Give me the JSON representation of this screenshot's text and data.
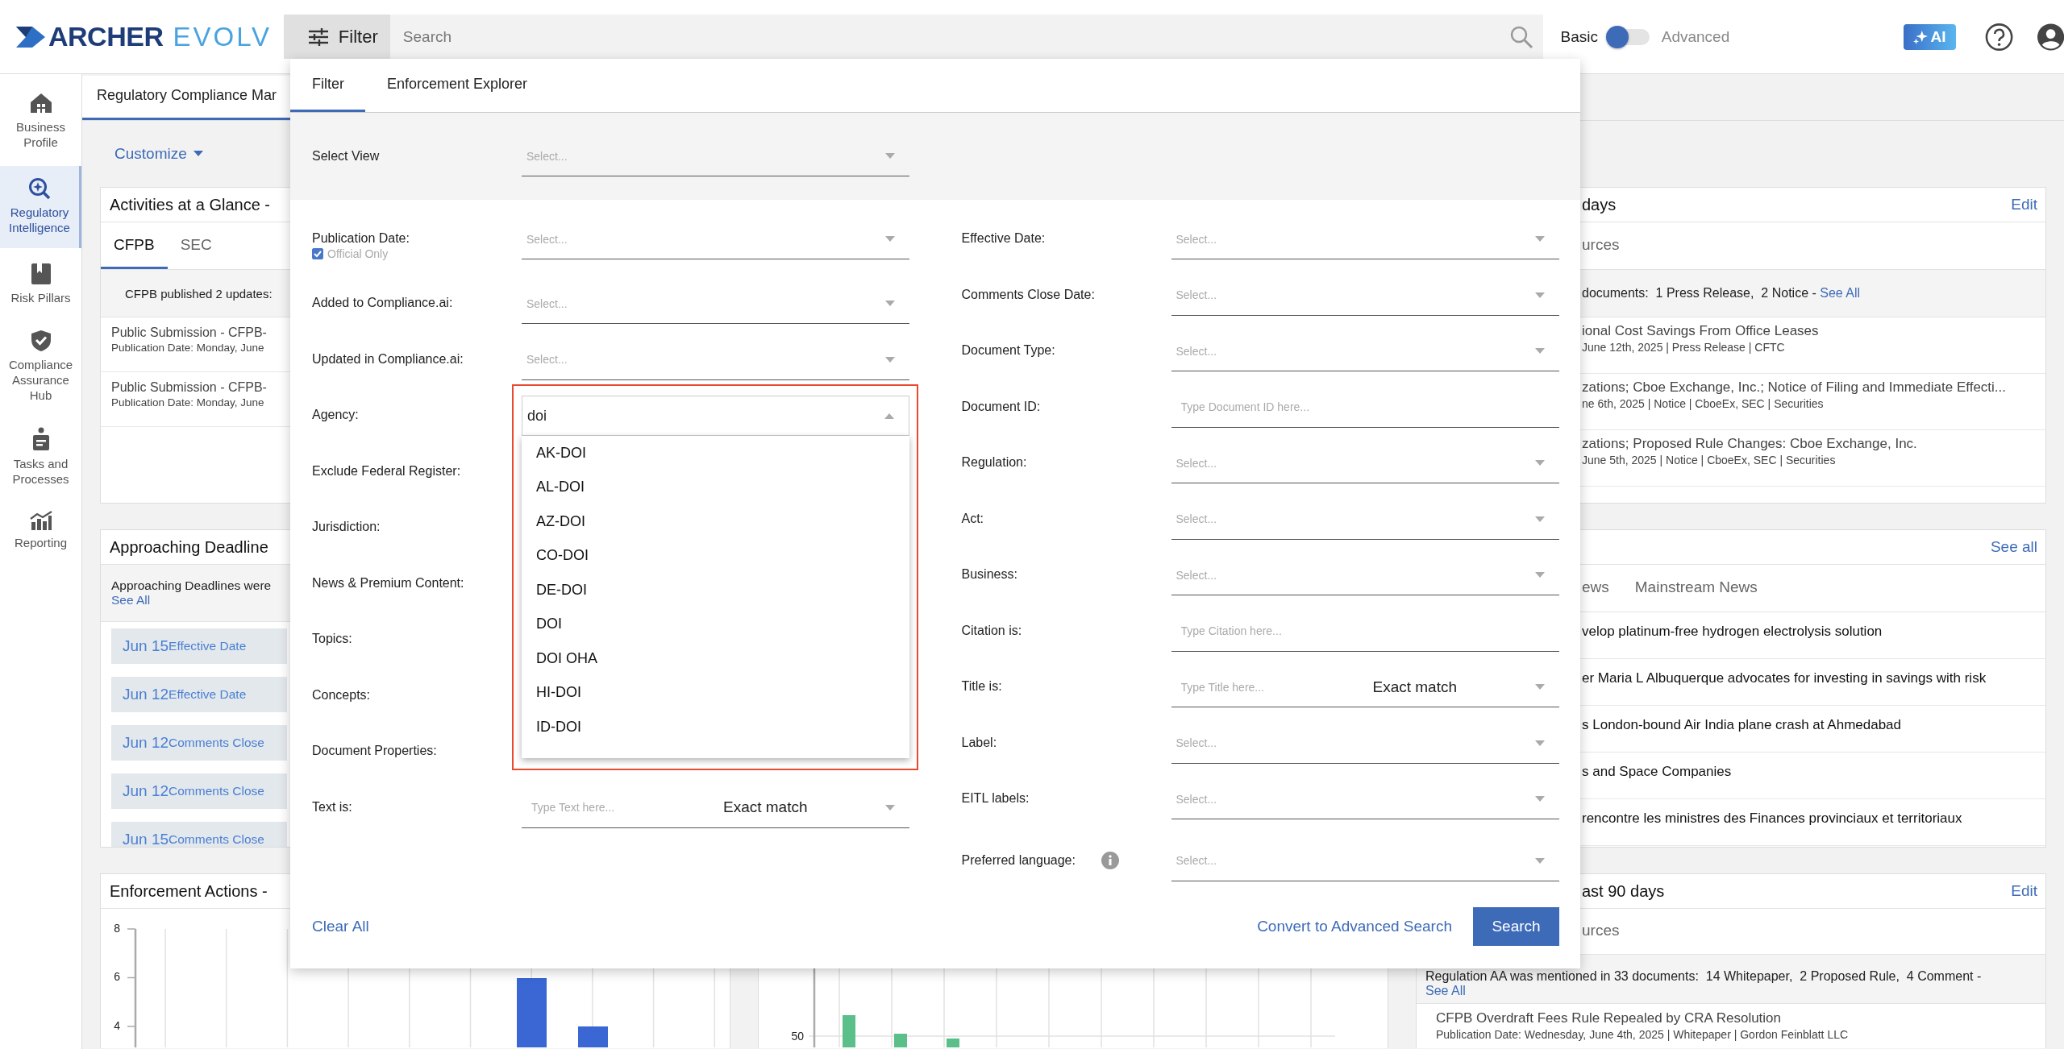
{
  "brand": {
    "word1": "ARCHER",
    "word2": "EVOLV"
  },
  "topbar": {
    "filter_button": "Filter",
    "search": {
      "placeholder": "Search"
    },
    "mode": {
      "basic_label": "Basic",
      "advanced_label": "Advanced",
      "advanced": false
    },
    "ai_button": "AI"
  },
  "sidebar": [
    {
      "label": "Business Profile",
      "selected": false
    },
    {
      "label": "Regulatory Intelligence",
      "selected": true
    },
    {
      "label": "Risk Pillars",
      "selected": false
    },
    {
      "label": "Compliance Assurance Hub",
      "selected": false
    },
    {
      "label": "Tasks and Processes",
      "selected": false
    },
    {
      "label": "Reporting",
      "selected": false
    }
  ],
  "page_tabs": [
    {
      "label": "Regulatory Compliance Mar",
      "selected": true
    }
  ],
  "customize": "Customize",
  "activities": {
    "title": "Activities at a Glance -",
    "tabs": [
      {
        "label": "CFPB",
        "selected": true
      },
      {
        "label": "SEC",
        "selected": false
      }
    ],
    "summary": "CFPB published 2 updates:",
    "items": [
      {
        "title": "Public Submission - CFPB-",
        "meta": "Publication Date: Monday, June"
      },
      {
        "title": "Public Submission - CFPB-",
        "meta": "Publication Date: Monday, June"
      }
    ]
  },
  "deadlines": {
    "title": "Approaching Deadline",
    "notice": "Approaching Deadlines were",
    "notice_link": "See All",
    "items": [
      {
        "date": "Jun 15",
        "type": "Effective Date"
      },
      {
        "date": "Jun 12",
        "type": "Effective Date"
      },
      {
        "date": "Jun 12",
        "type": "Comments Close"
      },
      {
        "date": "Jun 12",
        "type": "Comments Close"
      },
      {
        "date": "Jun 15",
        "type": "Comments Close"
      }
    ]
  },
  "enforcement": {
    "title": "Enforcement Actions -",
    "axis_ticks": [
      "8",
      "6",
      "4"
    ]
  },
  "middle_chart": {
    "axis_tick": "50"
  },
  "updates_card": {
    "title": "days",
    "edit": "Edit",
    "tab": "urces",
    "summary": "documents:  1 Press Release,  2 Notice - ",
    "summary_link": "See All",
    "items": [
      {
        "title": "ional Cost Savings From Office Leases",
        "meta": "June 12th, 2025 | Press Release | CFTC"
      },
      {
        "title": "zations; Cboe Exchange, Inc.; Notice of Filing and Immediate Effecti...",
        "meta": "ne 6th, 2025 | Notice | CboeEx, SEC | Securities"
      },
      {
        "title": "zations; Proposed Rule Changes: Cboe Exchange, Inc.",
        "meta": "June 5th, 2025 | Notice | CboeEx, SEC | Securities"
      }
    ]
  },
  "news_card": {
    "see_all": "See all",
    "tabs": [
      "ews",
      "Mainstream News"
    ],
    "items": [
      "velop platinum-free hydrogen electrolysis solution",
      "er Maria L Albuquerque advocates for investing in savings with risk",
      "s London-bound Air India plane crash at Ahmedabad",
      "s and Space Companies",
      "rencontre les ministres des Finances provinciaux et territoriaux"
    ]
  },
  "mentions_card": {
    "title": "ast 90 days",
    "edit": "Edit",
    "tab": "urces",
    "summary": "Regulation AA was mentioned in 33 documents:  14 Whitepaper,  2 Proposed Rule,  4 Comment - ",
    "summary_link": "See All",
    "items": [
      {
        "title": "CFPB Overdraft Fees Rule Repealed by CRA Resolution",
        "meta": "Publication Date: Wednesday, June 4th, 2025 | Whitepaper | Gordon Feinblatt LLC"
      }
    ]
  },
  "filter_panel": {
    "tabs": [
      {
        "label": "Filter",
        "selected": true
      },
      {
        "label": "Enforcement Explorer",
        "selected": false
      }
    ],
    "select_view": {
      "label": "Select View",
      "placeholder": "Select..."
    },
    "left_fields": [
      {
        "label": "Publication Date:",
        "kind": "select",
        "placeholder": "Select...",
        "checkbox": {
          "label": "Official Only",
          "checked": true
        }
      },
      {
        "label": "Added to Compliance.ai:",
        "kind": "select",
        "placeholder": "Select..."
      },
      {
        "label": "Updated in Compliance.ai:",
        "kind": "select",
        "placeholder": "Select..."
      },
      {
        "label": "Agency:",
        "kind": "combo",
        "value": "doi",
        "expanded": true,
        "highlighted": true,
        "options": [
          "AK-DOI",
          "AL-DOI",
          "AZ-DOI",
          "CO-DOI",
          "DE-DOI",
          "DOI",
          "DOI OHA",
          "HI-DOI",
          "ID-DOI"
        ]
      },
      {
        "label": "Exclude Federal Register:",
        "kind": "covered"
      },
      {
        "label": "Jurisdiction:",
        "kind": "covered"
      },
      {
        "label": "News & Premium Content:",
        "kind": "covered"
      },
      {
        "label": "Topics:",
        "kind": "covered"
      },
      {
        "label": "Concepts:",
        "kind": "covered"
      },
      {
        "label": "Document Properties:",
        "kind": "covered"
      },
      {
        "label": "Text is:",
        "kind": "text_match",
        "placeholder": "Type Text here...",
        "match": "Exact match"
      }
    ],
    "right_fields": [
      {
        "label": "Effective Date:",
        "kind": "select",
        "placeholder": "Select..."
      },
      {
        "label": "Comments Close Date:",
        "kind": "select",
        "placeholder": "Select..."
      },
      {
        "label": "Document Type:",
        "kind": "select",
        "placeholder": "Select..."
      },
      {
        "label": "Document ID:",
        "kind": "text",
        "placeholder": "Type Document ID here..."
      },
      {
        "label": "Regulation:",
        "kind": "select",
        "placeholder": "Select..."
      },
      {
        "label": "Act:",
        "kind": "select",
        "placeholder": "Select..."
      },
      {
        "label": "Business:",
        "kind": "select",
        "placeholder": "Select..."
      },
      {
        "label": "Citation is:",
        "kind": "text",
        "placeholder": "Type Citation here..."
      },
      {
        "label": "Title is:",
        "kind": "text_match",
        "placeholder": "Type Title here...",
        "match": "Exact match"
      },
      {
        "label": "Label:",
        "kind": "select",
        "placeholder": "Select..."
      },
      {
        "label": "EITL labels:",
        "kind": "select",
        "placeholder": "Select..."
      },
      {
        "label": "Preferred language:",
        "kind": "select",
        "placeholder": "Select...",
        "info": true
      }
    ],
    "clear_all": "Clear All",
    "convert": "Convert to Advanced Search",
    "search_button": "Search"
  }
}
